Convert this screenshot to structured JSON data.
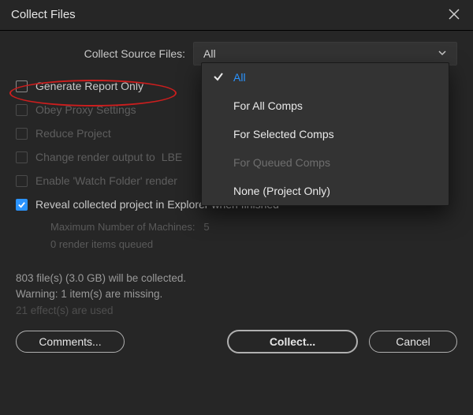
{
  "titlebar": {
    "title": "Collect Files"
  },
  "collect_source": {
    "label": "Collect Source Files:",
    "selected": "All"
  },
  "dropdown_options": {
    "o0": "All",
    "o1": "For All Comps",
    "o2": "For Selected Comps",
    "o3": "For Queued Comps",
    "o4": "None (Project Only)"
  },
  "checkboxes": {
    "generate_report": "Generate Report Only",
    "obey_proxy": "Obey Proxy Settings",
    "reduce_project": "Reduce Project",
    "change_render_prefix": "Change render output to",
    "change_render_suffix": "LBE",
    "enable_watch": "Enable 'Watch Folder' render",
    "reveal": "Reveal collected project in Explorer when finished"
  },
  "subinfo": {
    "max_machines_label": "Maximum Number of Machines:",
    "max_machines_value": "5",
    "queued": "0 render items queued"
  },
  "status": {
    "line1": "803 file(s) (3.0 GB) will be collected.",
    "line2": "Warning: 1 item(s) are missing.",
    "line3": "21 effect(s) are used"
  },
  "buttons": {
    "comments": "Comments...",
    "collect": "Collect...",
    "cancel": "Cancel"
  }
}
